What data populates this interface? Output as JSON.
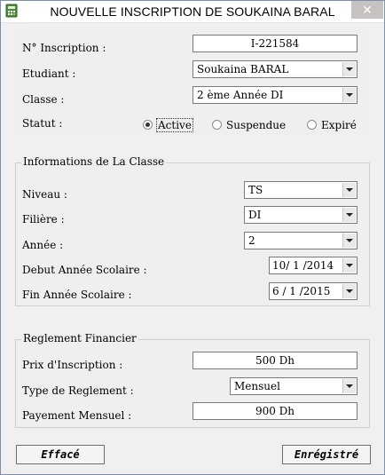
{
  "window": {
    "title": "NOUVELLE INSCRIPTION DE SOUKAINA BARAL",
    "close_glyph": "✕"
  },
  "inscription": {
    "numero_label": "N° Inscription :",
    "numero_value": "I-221584",
    "etudiant_label": "Etudiant :",
    "etudiant_value": "Soukaina BARAL",
    "classe_label": "Classe :",
    "classe_value": "2 ème Année DI",
    "statut_label": "Statut :",
    "statut_options": [
      "Active",
      "Suspendue",
      "Expiré"
    ],
    "statut_selected": "Active"
  },
  "classe_info": {
    "legend": "Informations de La Classe",
    "niveau_label": "Niveau :",
    "niveau_value": "TS",
    "filiere_label": "Filière :",
    "filiere_value": "DI",
    "annee_label": "Année :",
    "annee_value": "2",
    "debut_label": "Debut Année Scolaire :",
    "debut_value": "10/ 1 /2014",
    "fin_label": "Fin Année Scolaire :",
    "fin_value": "6 / 1 /2015"
  },
  "reglement": {
    "legend": "Reglement Financier",
    "prix_label": "Prix d'Inscription :",
    "prix_value": "500 Dh",
    "type_label": "Type de Reglement :",
    "type_value": "Mensuel",
    "mensuel_label": "Payement Mensuel :",
    "mensuel_value": "900 Dh"
  },
  "buttons": {
    "effacer": "Effacé",
    "enregistrer": "Enrégistré"
  },
  "icons": {
    "app": "calculator-icon",
    "close": "close-icon",
    "dropdown": "chevron-down-icon"
  }
}
